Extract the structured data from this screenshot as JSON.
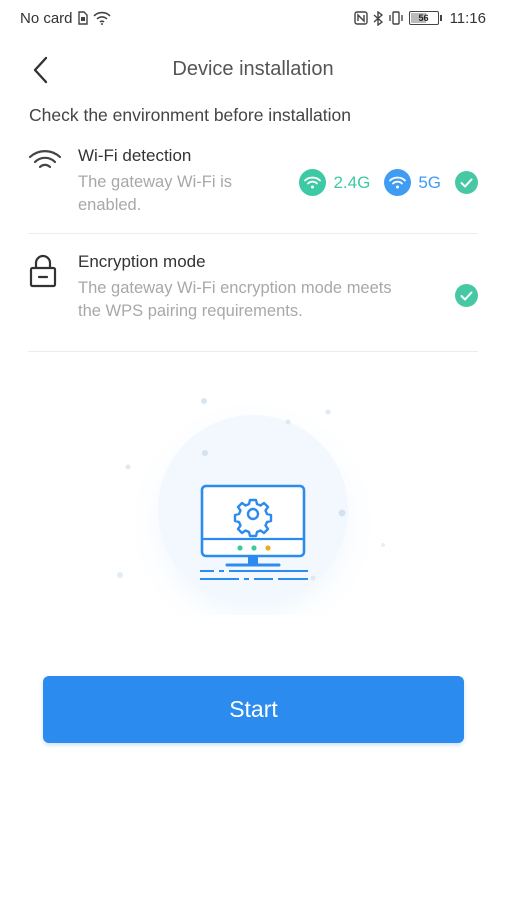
{
  "status_bar": {
    "carrier": "No card",
    "battery_level": "56",
    "time": "11:16"
  },
  "header": {
    "title": "Device installation"
  },
  "subtitle": "Check the environment before installation",
  "checks": {
    "wifi": {
      "title": "Wi-Fi detection",
      "description": "The gateway Wi-Fi is enabled.",
      "band_24_label": "2.4G",
      "band_5_label": "5G",
      "status": "passed"
    },
    "encryption": {
      "title": "Encryption mode",
      "description": "The gateway Wi-Fi encryption mode meets the WPS pairing requirements.",
      "status": "passed"
    }
  },
  "start_button": {
    "label": "Start"
  },
  "colors": {
    "primary": "#2c8bef",
    "success": "#47c8a4",
    "band_24": "#3dc9a3",
    "band_5": "#3f9cf3",
    "muted_text": "#a8a8a8"
  },
  "icons": {
    "back": "chevron-left-icon",
    "wifi": "wifi-icon",
    "lock": "lock-icon",
    "check": "check-circle-icon",
    "device": "monitor-gear-icon"
  }
}
